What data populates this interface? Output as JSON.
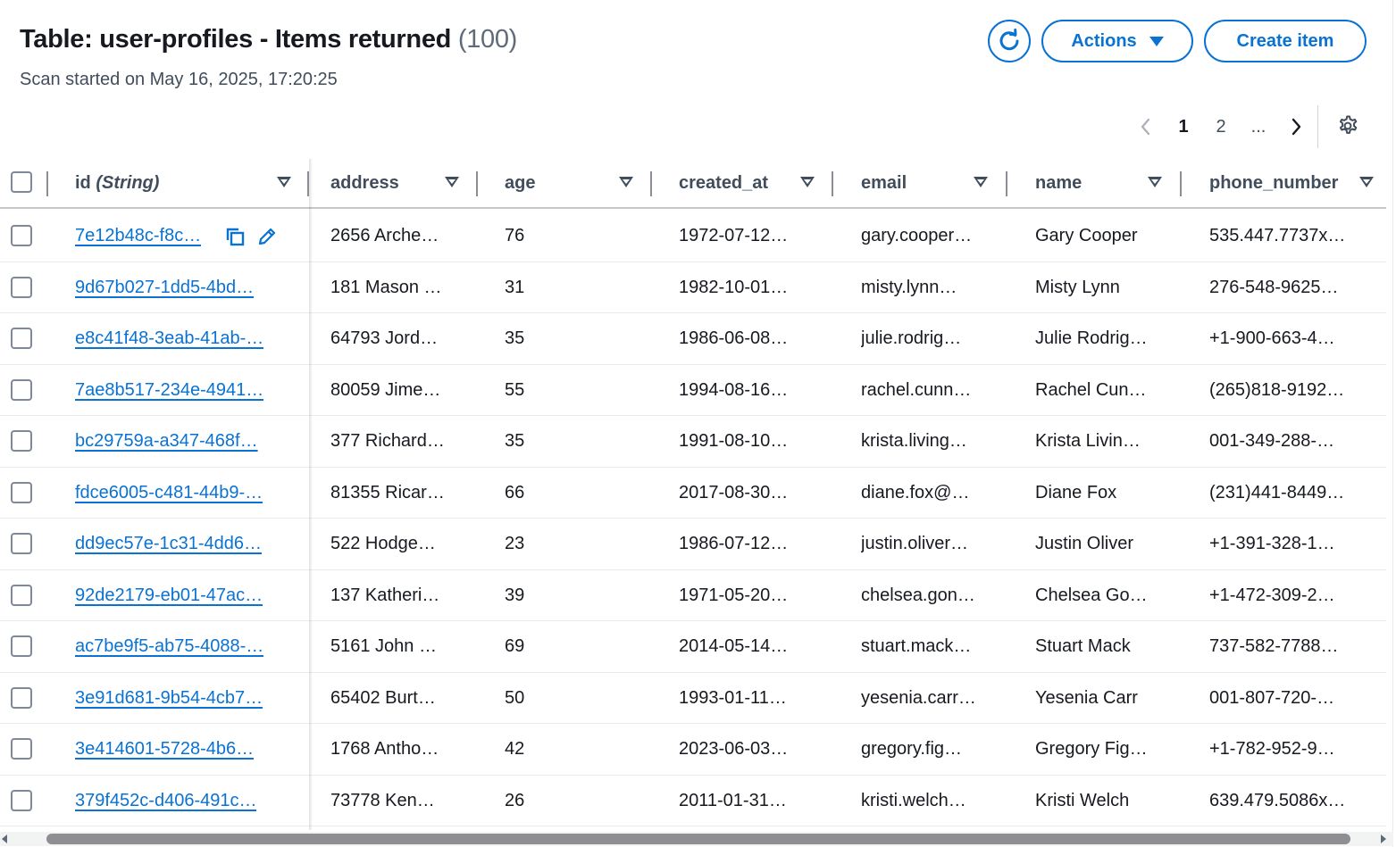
{
  "header": {
    "title": "Table: user-profiles - Items returned",
    "count": "(100)",
    "subtitle": "Scan started on May 16, 2025, 17:20:25",
    "actions_label": "Actions",
    "create_label": "Create item"
  },
  "pagination": {
    "pages": [
      "1",
      "2",
      "..."
    ],
    "current": "1"
  },
  "columns": [
    {
      "label": "id",
      "type": "(String)"
    },
    {
      "label": "address"
    },
    {
      "label": "age"
    },
    {
      "label": "created_at"
    },
    {
      "label": "email"
    },
    {
      "label": "name"
    },
    {
      "label": "phone_number"
    }
  ],
  "rows": [
    {
      "id": "7e12b48c-f8c…",
      "address": "2656 Arche…",
      "age": "76",
      "created_at": "1972-07-12…",
      "email": "gary.cooper…",
      "name": "Gary Cooper",
      "phone": "535.447.7737x…"
    },
    {
      "id": "9d67b027-1dd5-4bd…",
      "address": "181 Mason …",
      "age": "31",
      "created_at": "1982-10-01…",
      "email": "misty.lynn…",
      "name": "Misty Lynn",
      "phone": "276-548-9625…"
    },
    {
      "id": "e8c41f48-3eab-41ab-…",
      "address": "64793 Jord…",
      "age": "35",
      "created_at": "1986-06-08…",
      "email": "julie.rodrig…",
      "name": "Julie Rodrig…",
      "phone": "+1-900-663-4…"
    },
    {
      "id": "7ae8b517-234e-4941…",
      "address": "80059 Jime…",
      "age": "55",
      "created_at": "1994-08-16…",
      "email": "rachel.cunn…",
      "name": "Rachel Cun…",
      "phone": "(265)818-9192…"
    },
    {
      "id": "bc29759a-a347-468f…",
      "address": "377 Richard…",
      "age": "35",
      "created_at": "1991-08-10…",
      "email": "krista.living…",
      "name": "Krista Livin…",
      "phone": "001-349-288-…"
    },
    {
      "id": "fdce6005-c481-44b9-…",
      "address": "81355 Ricar…",
      "age": "66",
      "created_at": "2017-08-30…",
      "email": "diane.fox@…",
      "name": "Diane Fox",
      "phone": "(231)441-8449…"
    },
    {
      "id": "dd9ec57e-1c31-4dd6…",
      "address": "522 Hodge…",
      "age": "23",
      "created_at": "1986-07-12…",
      "email": "justin.oliver…",
      "name": "Justin Oliver",
      "phone": "+1-391-328-1…"
    },
    {
      "id": "92de2179-eb01-47ac…",
      "address": "137 Katheri…",
      "age": "39",
      "created_at": "1971-05-20…",
      "email": "chelsea.gon…",
      "name": "Chelsea Go…",
      "phone": "+1-472-309-2…"
    },
    {
      "id": "ac7be9f5-ab75-4088-…",
      "address": "5161 John …",
      "age": "69",
      "created_at": "2014-05-14…",
      "email": "stuart.mack…",
      "name": "Stuart Mack",
      "phone": "737-582-7788…"
    },
    {
      "id": "3e91d681-9b54-4cb7…",
      "address": "65402 Burt…",
      "age": "50",
      "created_at": "1993-01-11…",
      "email": "yesenia.carr…",
      "name": "Yesenia Carr",
      "phone": "001-807-720-…"
    },
    {
      "id": "3e414601-5728-4b6…",
      "address": "1768 Antho…",
      "age": "42",
      "created_at": "2023-06-03…",
      "email": "gregory.fig…",
      "name": "Gregory Fig…",
      "phone": "+1-782-952-9…"
    },
    {
      "id": "379f452c-d406-491c…",
      "address": "73778 Ken…",
      "age": "26",
      "created_at": "2011-01-31…",
      "email": "kristi.welch…",
      "name": "Kristi Welch",
      "phone": "639.479.5086x…"
    }
  ],
  "colors": {
    "accent": "#0972d3",
    "text": "#16191f",
    "muted": "#414d5c"
  }
}
